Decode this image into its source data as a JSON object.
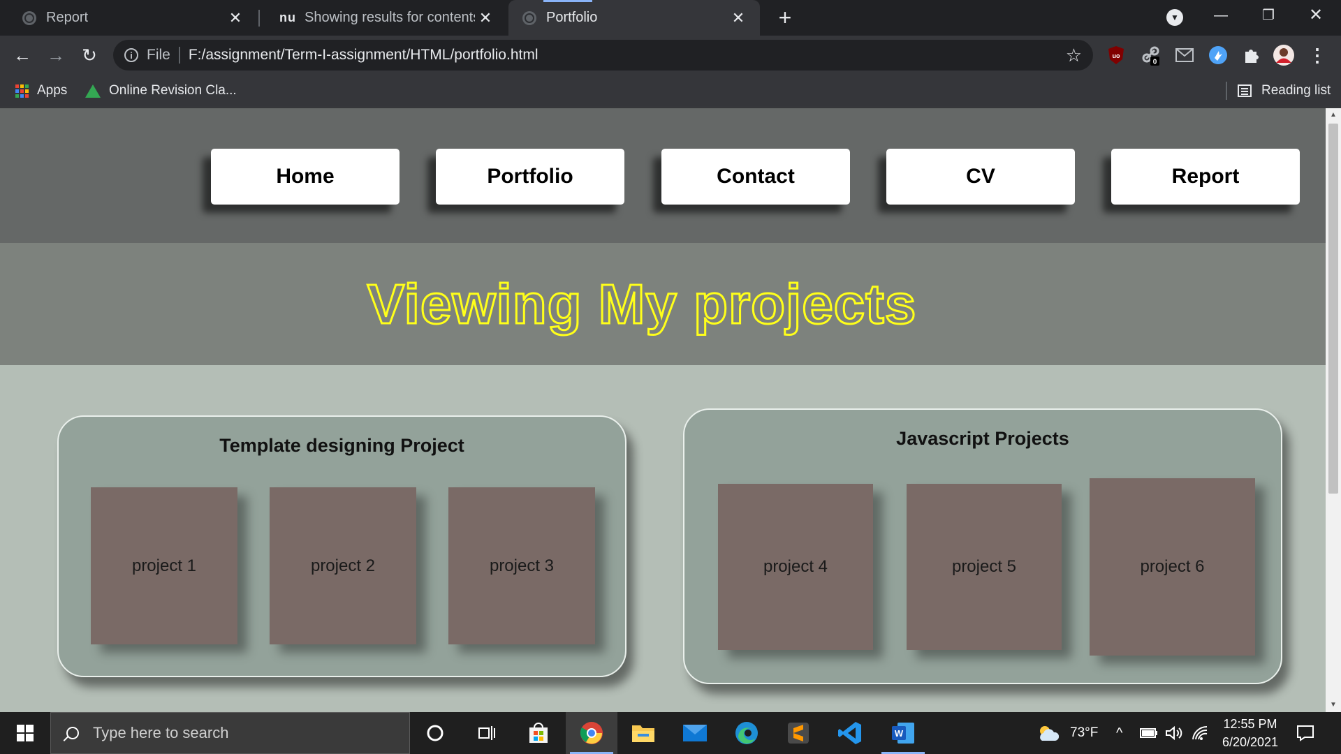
{
  "browser": {
    "tabs": [
      {
        "title": "Report",
        "favicon": "globe-icon"
      },
      {
        "title": "Showing results for contents of t",
        "favicon": "nu-logo",
        "favicon_text": "nu"
      },
      {
        "title": "Portfolio",
        "favicon": "globe-icon",
        "active": true
      }
    ],
    "new_tab_icon": "+",
    "address": {
      "scheme_label": "File",
      "url": "F:/assignment/Term-I-assignment/HTML/portfolio.html"
    },
    "extension_badge": "0",
    "bookmarks": [
      {
        "label": "Apps",
        "icon": "apps-grid-icon"
      },
      {
        "label": "Online Revision Cla...",
        "icon": "google-drive-icon"
      }
    ],
    "reading_list_label": "Reading list"
  },
  "page": {
    "nav": [
      "Home",
      "Portfolio",
      "Contact",
      "CV",
      "Report"
    ],
    "hero_title": "Viewing My projects",
    "sections": [
      {
        "title": "Template designing Project",
        "projects": [
          "project 1",
          "project 2",
          "project 3"
        ]
      },
      {
        "title": "Javascript Projects",
        "projects": [
          "project 4",
          "project 5",
          "project 6"
        ]
      }
    ]
  },
  "taskbar": {
    "search_placeholder": "Type here to search",
    "weather": "73°F",
    "time": "12:55 PM",
    "date": "6/20/2021"
  },
  "colors": {
    "nav_bg": "#656867",
    "hero_bg": "#7d827d",
    "hero_text_stroke": "#ffff1a",
    "content_bg": "#b4beb6",
    "panel_bg": "#93a29a",
    "project_box": "#7a6a66"
  }
}
